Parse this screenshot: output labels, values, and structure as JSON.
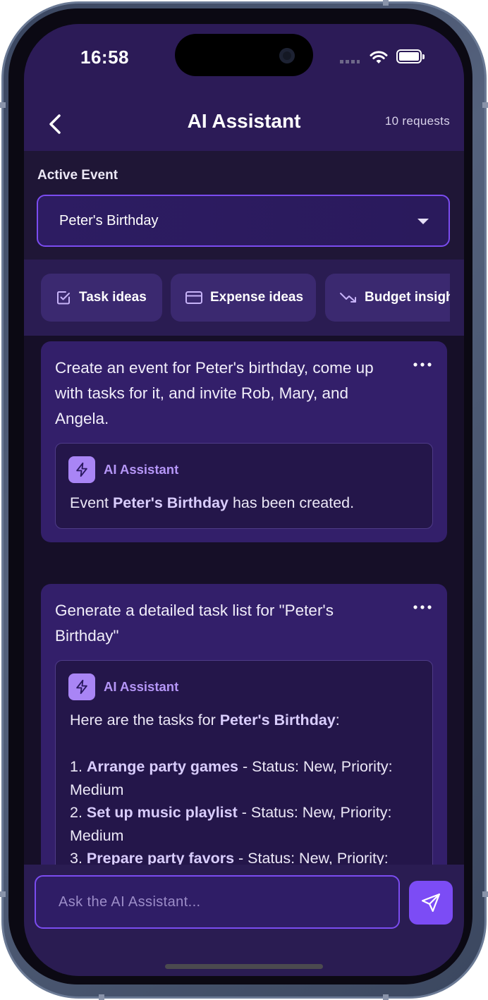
{
  "status_bar": {
    "time": "16:58"
  },
  "header": {
    "title": "AI Assistant",
    "requests": "10 requests"
  },
  "active_event": {
    "label": "Active Event",
    "selected": "Peter's Birthday"
  },
  "chips": [
    {
      "label": "Task ideas",
      "icon": "checkbox-icon"
    },
    {
      "label": "Expense ideas",
      "icon": "credit-card-icon"
    },
    {
      "label": "Budget insights",
      "icon": "trending-down-icon"
    }
  ],
  "messages": [
    {
      "prompt": "Create an event for Peter's birthday, come up with tasks for it, and invite Rob, Mary, and Angela.",
      "reply": {
        "author": "AI Assistant",
        "pre": "Event ",
        "bold": "Peter's Birthday",
        "post": " has been created."
      }
    },
    {
      "prompt": "Generate a detailed task list for \"Peter's Birthday\"",
      "reply": {
        "author": "AI Assistant",
        "intro_pre": "Here are the tasks for ",
        "intro_bold": "Peter's Birthday",
        "intro_post": ":",
        "tasks": [
          {
            "num": "1. ",
            "name": "Arrange party games",
            "details": " - Status: New, Priority: Medium"
          },
          {
            "num": "2. ",
            "name": "Set up music playlist",
            "details": " - Status: New, Priority: Medium"
          },
          {
            "num": "3. ",
            "name": "Prepare party favors",
            "details": " - Status: New, Priority: Medium"
          }
        ]
      }
    }
  ],
  "composer": {
    "placeholder": "Ask the AI Assistant..."
  },
  "colors": {
    "accent": "#7c4cf5",
    "header_bg": "#2c1b57",
    "card_bg": "#331f6a",
    "reply_name": "#b596f7"
  }
}
